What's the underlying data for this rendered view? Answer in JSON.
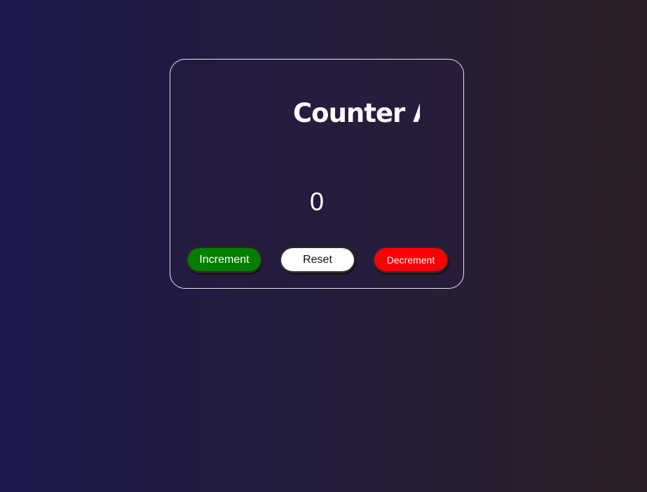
{
  "app": {
    "title": "Counter App"
  },
  "counter": {
    "value": "0"
  },
  "buttons": {
    "increment_label": "Increment",
    "reset_label": "Reset",
    "decrement_label": "Decrement"
  },
  "colors": {
    "background_left": "#1c1a4d",
    "background_right": "#2d2027",
    "card_border": "#e6e6ee",
    "increment": "#008000",
    "reset": "#ffffff",
    "decrement": "#ff0000",
    "text": "#ffffff"
  }
}
